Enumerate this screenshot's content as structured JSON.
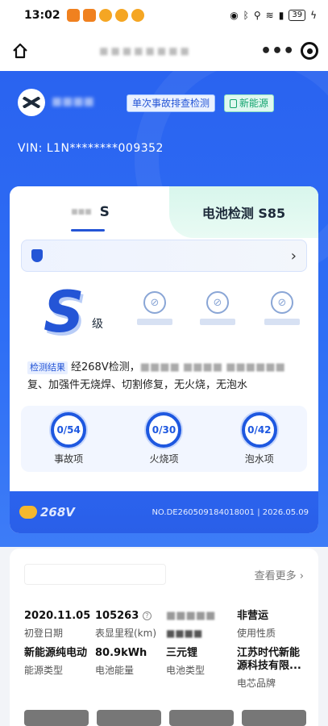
{
  "status_bar": {
    "time": "13:02",
    "battery": "39"
  },
  "nav": {
    "more": "•••"
  },
  "header": {
    "tag_primary": "单次事故排查检测",
    "tag_energy": "新能源",
    "vin": "VIN: L1N********009352"
  },
  "report": {
    "tab_left_label": "S",
    "tab_right_label": "电池检测 S85",
    "grade": "S",
    "grade_suffix": "级",
    "result_tag": "检测结果",
    "result_text_start": "经268V检测，",
    "result_text_end": "复、加强件无烧焊、切割修复，无火烧，无泡水",
    "counters": [
      {
        "value": "0/54",
        "label": "事故项"
      },
      {
        "value": "0/30",
        "label": "火烧项"
      },
      {
        "value": "0/42",
        "label": "泡水项"
      }
    ],
    "footer_logo": "268V",
    "footer_no": "NO.DE260509184018001 | 2026.05.09"
  },
  "details": {
    "see_more": "查看更多",
    "cells": [
      {
        "value": "2020.11.05",
        "key": "初登日期"
      },
      {
        "value": "105263",
        "key": "表显里程(km)"
      },
      {
        "value": "",
        "key": ""
      },
      {
        "value": "非营运",
        "key": "使用性质"
      },
      {
        "value": "新能源纯电动",
        "key": "能源类型"
      },
      {
        "value": "80.9kWh",
        "key": "电池能量"
      },
      {
        "value": "三元锂",
        "key": "电池类型"
      },
      {
        "value": "江苏时代新能源科技有限...",
        "key": "电芯品牌"
      }
    ]
  }
}
